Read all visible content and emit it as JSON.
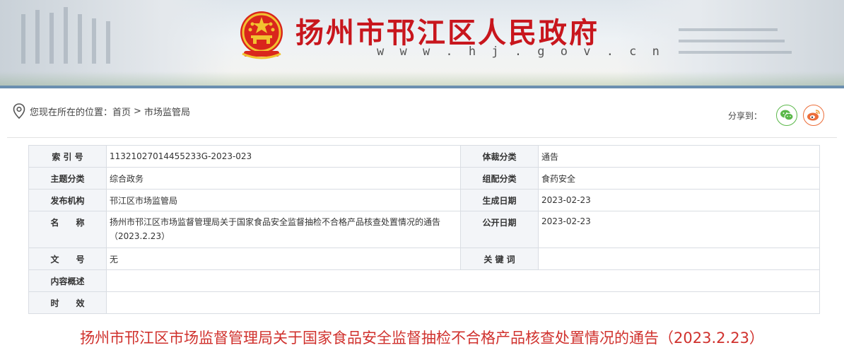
{
  "header": {
    "site_title": "扬州市邗江区人民政府",
    "site_url": "w w w . h j . g o v . c n",
    "emblem_icon": "national-emblem-icon",
    "brand_color": "#c8161d"
  },
  "breadcrumb": {
    "prefix": "您现在所在的位置：",
    "home": "首页",
    "separator": ">",
    "current": "市场监管局",
    "icon": "location-pin-icon"
  },
  "share": {
    "label": "分享到：",
    "wechat_icon": "wechat-icon",
    "weibo_icon": "weibo-icon"
  },
  "meta_table": {
    "rows": [
      {
        "k1": "索 引 号",
        "v1": "11321027014455233G-2023-023",
        "k2": "体裁分类",
        "v2": "通告"
      },
      {
        "k1": "主题分类",
        "v1": "综合政务",
        "k2": "组配分类",
        "v2": "食药安全"
      },
      {
        "k1": "发布机构",
        "v1": "邗江区市场监管局",
        "k2": "生成日期",
        "v2": "2023-02-23"
      },
      {
        "k1": "名　　称",
        "v1": "扬州市邗江区市场监督管理局关于国家食品安全监督抽检不合格产品核查处置情况的通告（2023.2.23）",
        "k2": "公开日期",
        "v2": "2023-02-23"
      },
      {
        "k1": "文　　号",
        "v1": "无",
        "k2": "关 键 词",
        "v2": ""
      }
    ],
    "summary_label": "内容概述",
    "summary_value": "",
    "validity_label": "时　　效",
    "validity_value": ""
  },
  "document": {
    "title": "扬州市邗江区市场监督管理局关于国家食品安全监督抽检不合格产品核查处置情况的通告（2023.2.23）",
    "title_color": "#d0312d"
  }
}
